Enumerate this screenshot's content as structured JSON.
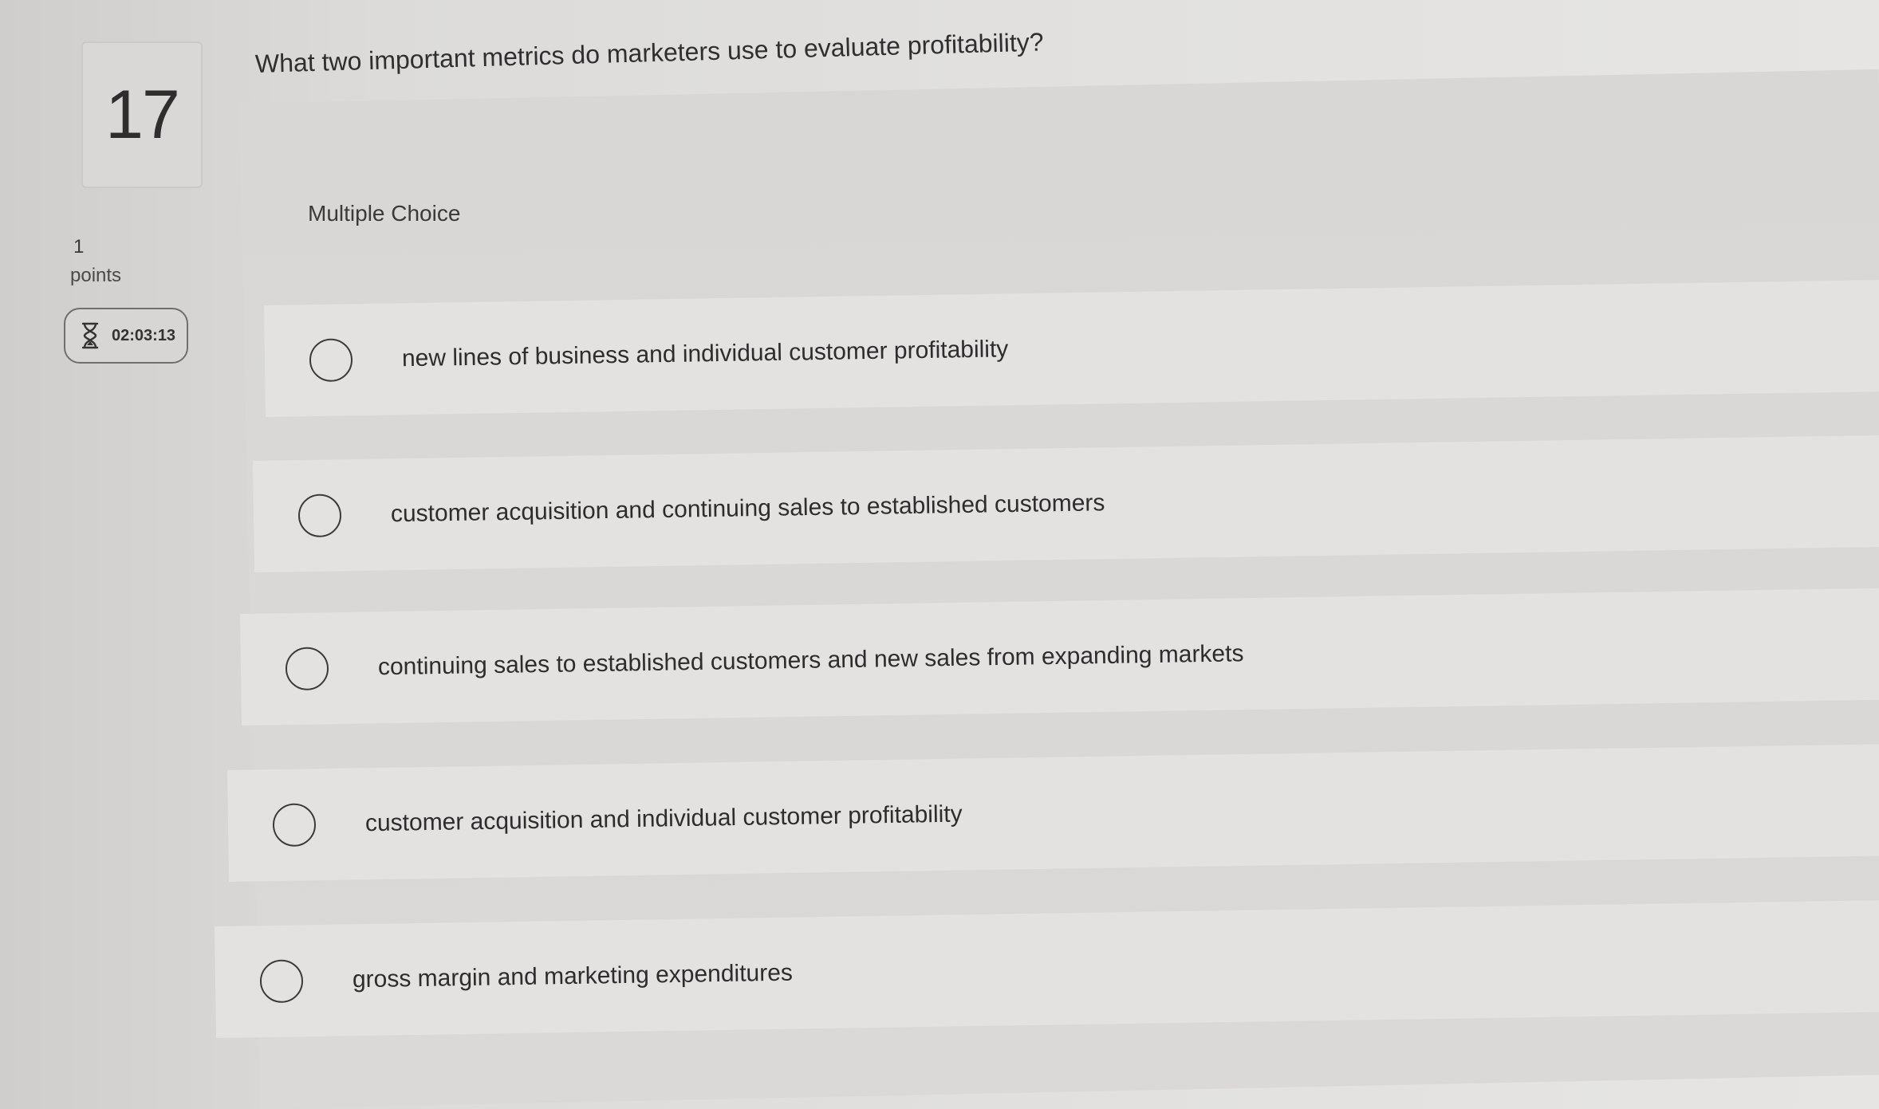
{
  "question": {
    "number": "17",
    "points_value": "1",
    "points_label": "points",
    "timer": "02:03:13",
    "text": "What two important metrics do marketers use to evaluate profitability?",
    "type_label": "Multiple Choice",
    "options": [
      {
        "label": "new lines of business and individual customer profitability"
      },
      {
        "label": "customer acquisition and continuing sales to established customers"
      },
      {
        "label": "continuing sales to established customers and new sales from expanding markets"
      },
      {
        "label": "customer acquisition and individual customer profitability"
      },
      {
        "label": "gross margin and marketing expenditures"
      }
    ]
  },
  "icons": {
    "timer": "hourglass-icon",
    "option": "radio-button"
  }
}
